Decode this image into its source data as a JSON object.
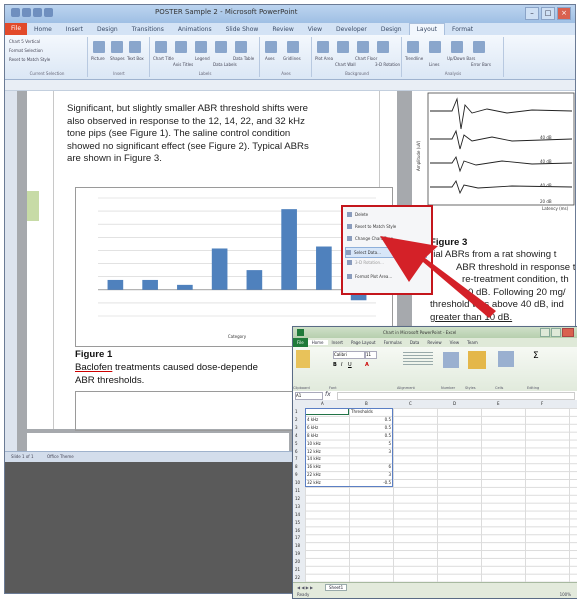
{
  "word": {
    "title": "POSTER Sample 2 - Microsoft PowerPoint",
    "tabs": [
      "File",
      "Home",
      "Insert",
      "Design",
      "Transitions",
      "Animations",
      "Slide Show",
      "Review",
      "View",
      "Developer",
      "Design",
      "Layout",
      "Format"
    ],
    "active_tab": 10,
    "ribbon_groups": [
      {
        "name": "Current Selection",
        "items": [
          "Chart 5 Vertical",
          "Format Selection",
          "Reset to Match Style"
        ]
      },
      {
        "name": "Insert",
        "items": [
          "Picture",
          "Shapes",
          "Text Box"
        ]
      },
      {
        "name": "Labels",
        "items": [
          "Chart Title",
          "Axis Titles",
          "Legend",
          "Data Labels",
          "Data Table"
        ]
      },
      {
        "name": "Axes",
        "items": [
          "Axes",
          "Gridlines"
        ]
      },
      {
        "name": "Background",
        "items": [
          "Plot Area",
          "Chart Wall",
          "Chart Floor",
          "3-D Rotation"
        ]
      },
      {
        "name": "Analysis",
        "items": [
          "Trendline",
          "Lines",
          "Up/Down Bars",
          "Error Bars"
        ]
      }
    ],
    "body_paragraph": [
      "Significant, but slightly smaller ABR threshold shifts were",
      "also observed in response to the 12, 14, 22, and 32 kHz",
      "tone pips (see Figure 1).  The saline control condition",
      "showed no significant effect (see Figure 2).  Typical ABRs",
      "are shown in Figure 3."
    ],
    "figure1_label": "Figure 1",
    "figure1_caption_word1": "Baclofen",
    "figure1_caption_rest": " treatments caused dose-depende",
    "figure1_caption_line2": "ABR thresholds.",
    "figure3_label": "Figure 3",
    "figure3_caption": [
      "rial ABRs from a rat showing t",
      "ABR threshold in response t",
      "re-treatment condition, th",
      "0 dB.  Following 20 mg/",
      "threshold was above 40 dB, ind",
      "greater than 10 dB."
    ],
    "abr_labels": [
      "40 dB",
      "40 dB",
      "40 dB",
      "20 dB"
    ],
    "abr_ylabel": "Amplitude (uV)",
    "abr_xlabel": "Latency (ms)",
    "status": [
      "Slide 1 of 1",
      "Office Theme"
    ],
    "context_menu": [
      "Delete",
      "Reset to Match Style",
      "Change Chart Type...",
      "Select Data...",
      "3-D Rotation...",
      "Format Plot Area..."
    ],
    "context_menu_selected": 3
  },
  "chart_data": {
    "type": "bar",
    "categories": [
      "",
      "",
      "",
      "",
      "",
      "",
      "",
      ""
    ],
    "values": [
      1.5,
      1.5,
      0.75,
      6.3,
      3,
      12.3,
      6.6,
      -1.6
    ],
    "ylim": [
      -4,
      14
    ],
    "xlabel": "Category",
    "grid": true,
    "bar_color": "#4f81bd"
  },
  "excel": {
    "title": "Chart in Microsoft PowerPoint - Excel",
    "tabs": [
      "File",
      "Home",
      "Insert",
      "Page Layout",
      "Formulas",
      "Data",
      "Review",
      "View",
      "Team"
    ],
    "name_box": "A1",
    "font_name": "Calibri",
    "font_size": "11",
    "ribbon_labels": [
      "Clipboard",
      "Font",
      "Alignment",
      "Number",
      "Styles",
      "Cells",
      "Editing"
    ],
    "columns": [
      "A",
      "B",
      "C",
      "D",
      "E",
      "F",
      "G",
      "H"
    ],
    "rows": [
      "1",
      "2",
      "3",
      "4",
      "5",
      "6",
      "7",
      "8",
      "9",
      "10",
      "11",
      "12",
      "13",
      "14",
      "15",
      "16",
      "17",
      "18",
      "19",
      "20",
      "21",
      "22"
    ],
    "header_b": "Thresholds",
    "cells": [
      {
        "a": "4 kHz",
        "b": "0.5"
      },
      {
        "a": "6 kHz",
        "b": "0.5"
      },
      {
        "a": "8 kHz",
        "b": "0.5"
      },
      {
        "a": "10 kHz",
        "b": "5"
      },
      {
        "a": "12 kHz",
        "b": "3"
      },
      {
        "a": "14 kHz",
        "b": ""
      },
      {
        "a": "16 kHz",
        "b": "6"
      },
      {
        "a": "22 kHz",
        "b": "3"
      },
      {
        "a": "32 kHz",
        "b": "-0.5"
      }
    ],
    "sheet_tab": "Sheet1",
    "status": "Ready",
    "zoom": "100%"
  },
  "colors": {
    "accent": "#c4161c",
    "chart_bar": "#4f81bd",
    "excel_green": "#1f7a3a",
    "word_blue": "#2b579a"
  }
}
